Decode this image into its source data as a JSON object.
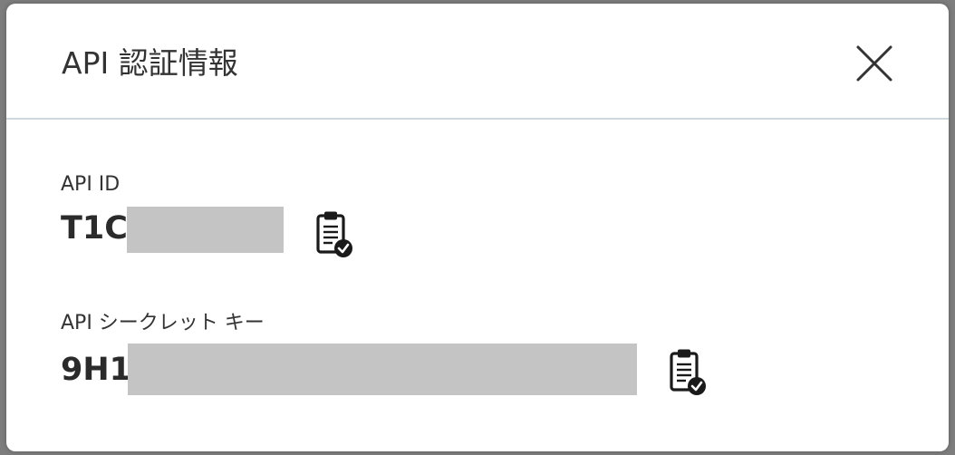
{
  "dialog": {
    "title": "API 認証情報",
    "close_label": "close"
  },
  "fields": [
    {
      "label": "API ID",
      "value_visible_prefix": "T1C",
      "copy_icon": "clipboard-check-icon"
    },
    {
      "label": "API シークレット キー",
      "value_visible_prefix": "9H1",
      "copy_icon": "clipboard-check-icon"
    }
  ],
  "colors": {
    "header_divider": "#cfd8dc",
    "text": "#333333",
    "redaction": "#c4c4c4",
    "backdrop": "#7d7d7d"
  }
}
